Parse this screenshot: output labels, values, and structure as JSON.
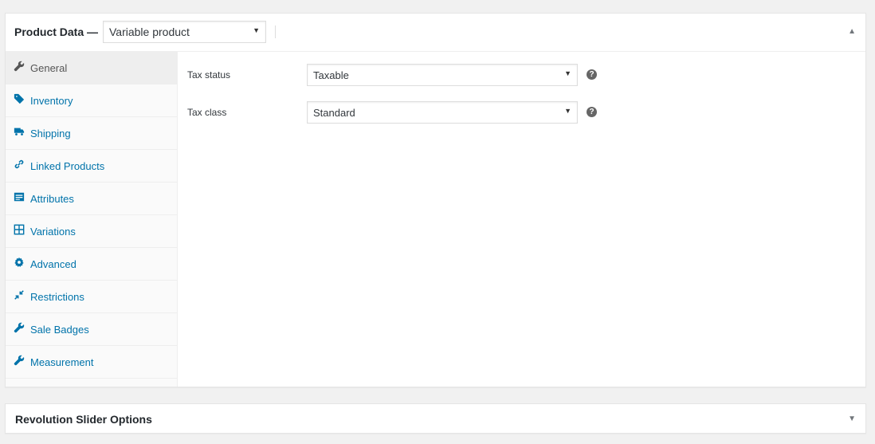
{
  "product_data": {
    "title": "Product Data —",
    "product_type": "Variable product",
    "toggle_icon": "triangle-up-icon"
  },
  "tabs": [
    {
      "label": "General",
      "icon": "wrench-icon",
      "active": true
    },
    {
      "label": "Inventory",
      "icon": "tag-icon",
      "active": false
    },
    {
      "label": "Shipping",
      "icon": "truck-icon",
      "active": false
    },
    {
      "label": "Linked Products",
      "icon": "link-icon",
      "active": false
    },
    {
      "label": "Attributes",
      "icon": "list-view-icon",
      "active": false
    },
    {
      "label": "Variations",
      "icon": "grid-icon",
      "active": false
    },
    {
      "label": "Advanced",
      "icon": "gear-icon",
      "active": false
    },
    {
      "label": "Restrictions",
      "icon": "compress-icon",
      "active": false
    },
    {
      "label": "Sale Badges",
      "icon": "wrench-icon",
      "active": false
    },
    {
      "label": "Measurement",
      "icon": "wrench-icon",
      "active": false
    }
  ],
  "general": {
    "tax_status": {
      "label": "Tax status",
      "value": "Taxable"
    },
    "tax_class": {
      "label": "Tax class",
      "value": "Standard"
    }
  },
  "revolution_slider": {
    "title": "Revolution Slider Options",
    "toggle_icon": "triangle-down-icon"
  },
  "colors": {
    "link": "#0073aa",
    "active_text": "#555555",
    "background": "#f1f1f1"
  }
}
